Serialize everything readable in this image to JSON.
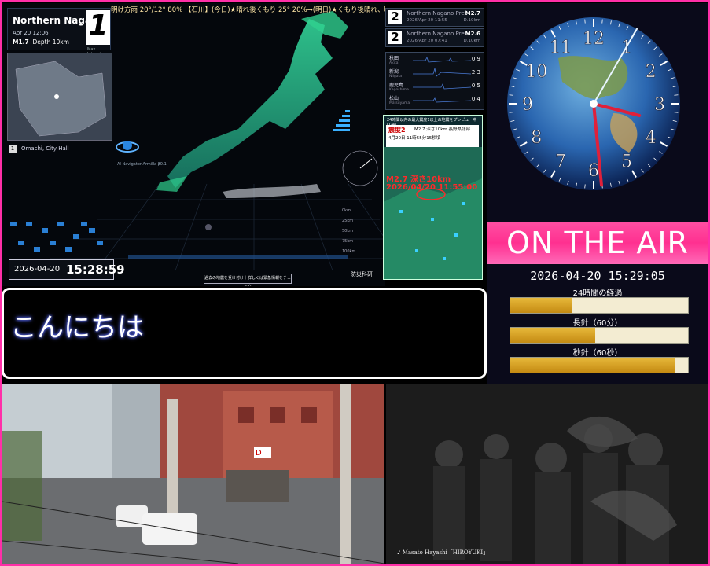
{
  "quake": {
    "ticker": "明け方雨 20°/12° 80% 【石川】(今日)★晴れ後くもり 25° 20%→(明日)★くもり後晴れ、明け方雨 19°/12",
    "region": "Northern Naga",
    "time": "Apr 20 12:06",
    "magnitude": "M1.7",
    "depth": "Depth 10km",
    "intensity": "1",
    "intensity_label": "Max Intensity",
    "location_index": "1",
    "location_name": "Omachi, City Hall",
    "navigator": "AI Navigator Armilla β0.1",
    "date": "2026-04-20",
    "clock": "15:28:59",
    "check_button": "過去の地震を受け付け｜詳しくは緊急情報をチェック",
    "bosai": "防災科研",
    "scale_labels": [
      "0km",
      "25km",
      "50km",
      "75km",
      "100km"
    ],
    "events": [
      {
        "num": "2",
        "name": "Northern Nagano Pref.",
        "time": "2026/Apr 20 11:55",
        "mag": "M2.7",
        "depth": "D.10km"
      },
      {
        "num": "2",
        "name": "Northern Nagano Pref.",
        "time": "2026/Apr 20 07:41",
        "mag": "M2.6",
        "depth": "D.10km"
      }
    ],
    "waves": [
      {
        "name": "秋田",
        "romaji": "Akita",
        "val": "0.9"
      },
      {
        "name": "新潟",
        "romaji": "Niigata",
        "val": "2.3"
      },
      {
        "name": "鹿児島",
        "romaji": "Kagoshima",
        "val": "0.5"
      },
      {
        "name": "松山",
        "romaji": "Matsuyama",
        "val": "0.4"
      }
    ],
    "preview": {
      "title": "24時間以内の最大震度1以上の地震をプレビュー中(1/4)",
      "shindo": "震度2",
      "detail": "M2.7 深さ10km 長野県北部",
      "when": "4月20日 11時55分15秒頃",
      "big1": "M2.7 深さ10km",
      "big2": "2026/04/20 11:55:00"
    }
  },
  "clock": {
    "numbers": [
      "12",
      "1",
      "2",
      "3",
      "4",
      "5",
      "6",
      "7",
      "8",
      "9",
      "10",
      "11"
    ],
    "hour": 3.48,
    "minute": 29.08,
    "second": 5,
    "on_air": "ON THE AIR",
    "datetime": "2026-04-20 15:29:05",
    "bars": [
      {
        "label": "24時間の経過",
        "fill": 0.35
      },
      {
        "label": "長針（60分）",
        "fill": 0.48
      },
      {
        "label": "秒針（60秒）",
        "fill": 0.93
      }
    ]
  },
  "greeting": "こんにちは",
  "music": "♪ Masato Hayashi「HIROYUKI」",
  "colors": {
    "frame": "#ff2fa8",
    "onair": "#ff3090",
    "bar": "#d89a20",
    "hand_red": "#e0203a"
  }
}
